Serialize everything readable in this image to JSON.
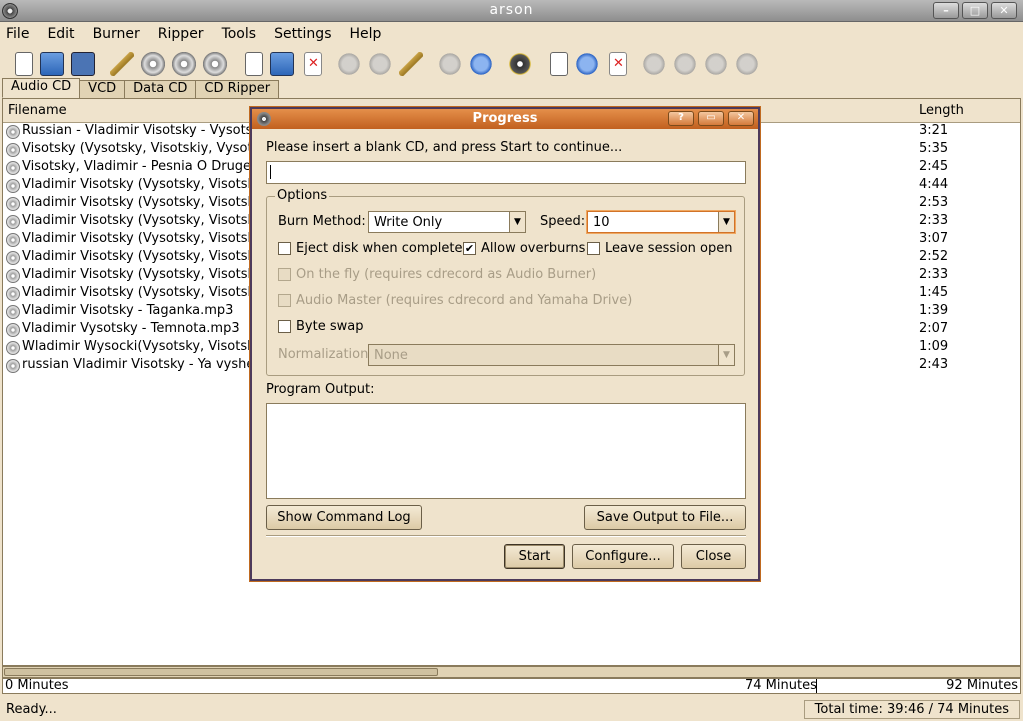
{
  "window": {
    "title": "arson"
  },
  "menubar": [
    "File",
    "Edit",
    "Burner",
    "Ripper",
    "Tools",
    "Settings",
    "Help"
  ],
  "tabs": [
    "Audio CD",
    "VCD",
    "Data CD",
    "CD Ripper"
  ],
  "list": {
    "col_filename": "Filename",
    "col_length": "Length",
    "rows": [
      {
        "name": "Russian - Vladimir Visotsky - Vysotsky",
        "length": "3:21"
      },
      {
        "name": "Visotsky (Vysotsky, Visotskiy, Vysotsky",
        "length": "5:35"
      },
      {
        "name": "Visotsky, Vladimir - Pesnia O Druge.mp3",
        "length": "2:45"
      },
      {
        "name": "Vladimir Visotsky (Vysotsky, Visotskiy",
        "length": "4:44"
      },
      {
        "name": "Vladimir Visotsky (Vysotsky, Visotskiy",
        "length": "2:53"
      },
      {
        "name": "Vladimir Visotsky (Vysotsky, Visotskiy",
        "length": "2:33"
      },
      {
        "name": "Vladimir Visotsky (Vysotsky, Visotskiy",
        "length": "3:07"
      },
      {
        "name": "Vladimir Visotsky (Vysotsky, Visotskiy",
        "length": "2:52"
      },
      {
        "name": "Vladimir Visotsky (Vysotsky, Visotskiy",
        "length": "2:33"
      },
      {
        "name": "Vladimir Visotsky (Vysotsky, Visotskiy",
        "length": "1:45"
      },
      {
        "name": "Vladimir Visotsky - Taganka.mp3",
        "length": "1:39"
      },
      {
        "name": "Vladimir Vysotsky - Temnota.mp3",
        "length": "2:07"
      },
      {
        "name": "Wladimir Wysocki(Vysotsky, Visotskiy,",
        "length": "1:09"
      },
      {
        "name": "russian Vladimir Visotsky - Ya vyshel",
        "length": "2:43"
      }
    ]
  },
  "capacity": {
    "start": "0 Minutes",
    "mark74": "74 Minutes",
    "mark92": "92 Minutes"
  },
  "status": {
    "left": "Ready...",
    "right": "Total time: 39:46 / 74 Minutes"
  },
  "dialog": {
    "title": "Progress",
    "message": "Please insert a blank CD, and press Start to continue...",
    "progress_text": "",
    "options_label": "Options",
    "burn_method_label": "Burn Method:",
    "burn_method_value": "Write Only",
    "speed_label": "Speed:",
    "speed_value": "10",
    "eject_label": "Eject disk when complete",
    "eject_checked": false,
    "overburn_label": "Allow overburns",
    "overburn_checked": true,
    "leave_session_label": "Leave session open",
    "leave_session_checked": false,
    "onthefly_label": "On the fly (requires cdrecord as Audio Burner)",
    "audiomaster_label": "Audio Master (requires cdrecord and Yamaha Drive)",
    "byteswap_label": "Byte swap",
    "normalization_label": "Normalization:",
    "normalization_value": "None",
    "program_output_label": "Program Output:",
    "show_log_label": "Show Command Log",
    "save_output_label": "Save Output to File...",
    "start_label": "Start",
    "configure_label": "Configure...",
    "close_label": "Close"
  },
  "colors": {
    "dialog_title": "#d47a3a",
    "background": "#efe3cc"
  }
}
